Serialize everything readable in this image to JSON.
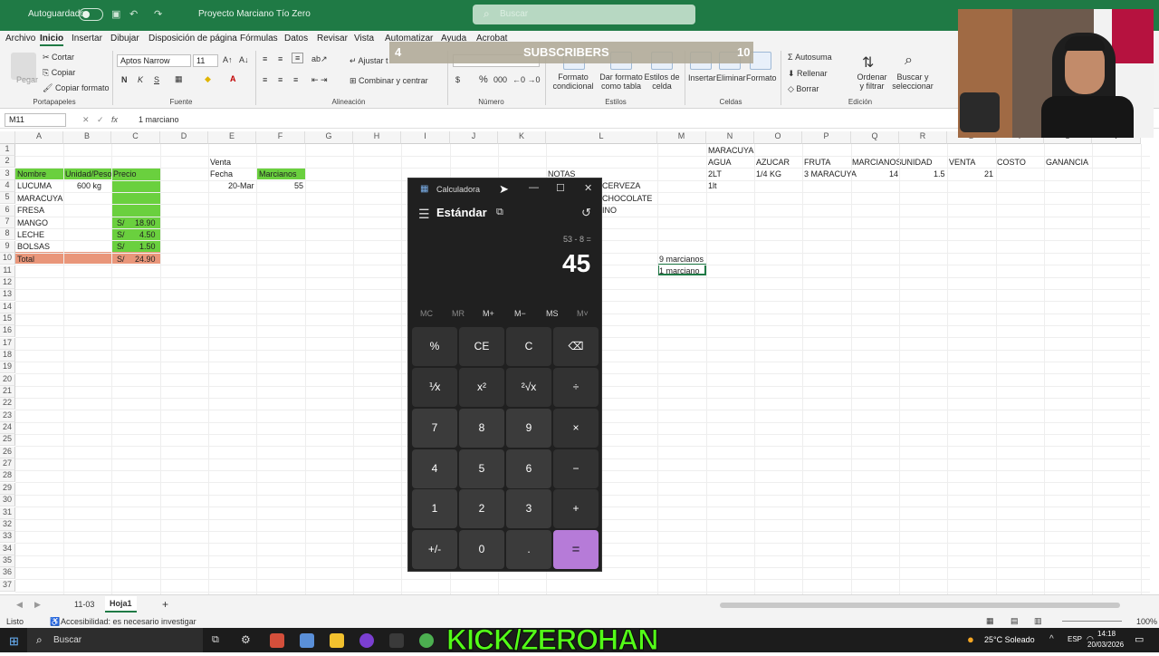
{
  "titlebar": {
    "autosave": "Autoguardado",
    "doc_title": "Proyecto Marciano Tío Zero",
    "search_placeholder": "Buscar"
  },
  "ribbon_tabs": [
    "Archivo",
    "Inicio",
    "Insertar",
    "Dibujar",
    "Disposición de página",
    "Fórmulas",
    "Datos",
    "Revisar",
    "Vista",
    "Automatizar",
    "Ayuda",
    "Acrobat"
  ],
  "ribbon": {
    "clipboard": {
      "paste": "Pegar",
      "cut": "Cortar",
      "copy": "Copiar",
      "format_painter": "Copiar formato",
      "group": "Portapapeles"
    },
    "font": {
      "name": "Aptos Narrow",
      "size": "11",
      "bold": "N",
      "italic": "K",
      "underline": "S",
      "group": "Fuente"
    },
    "alignment": {
      "wrap": "Ajustar t",
      "merge": "Combinar y centrar",
      "group": "Alineación"
    },
    "number": {
      "percent": "%",
      "group": "Número"
    },
    "styles": {
      "conditional": "Formato condicional",
      "as_table": "Dar formato como tabla",
      "cell_styles": "Estilos de celda",
      "group": "Estilos"
    },
    "cells": {
      "insert": "Insertar",
      "delete": "Eliminar",
      "format": "Formato",
      "group": "Celdas"
    },
    "editing": {
      "autosum": "Autosuma",
      "fill": "Rellenar",
      "clear": "Borrar",
      "sort": "Ordenar y filtrar",
      "find": "Buscar y seleccionar",
      "group": "Edición"
    }
  },
  "overlay": {
    "left_count": "4",
    "label": "SUBSCRIBERS",
    "right_count": "10",
    "brand": "KICK/ZEROHAN"
  },
  "formula": {
    "namebox": "M11",
    "fx": "fx",
    "value": "1 marciano"
  },
  "columns": [
    "A",
    "B",
    "C",
    "D",
    "E",
    "F",
    "G",
    "H",
    "I",
    "J",
    "K",
    "L",
    "M",
    "N",
    "O",
    "P",
    "Q",
    "R",
    "S",
    "T",
    "U",
    "V"
  ],
  "rows": [
    "1",
    "2",
    "3",
    "4",
    "5",
    "6",
    "7",
    "8",
    "9",
    "10",
    "11",
    "12",
    "13",
    "14",
    "15",
    "16",
    "17",
    "18",
    "19",
    "20",
    "21",
    "22",
    "23",
    "24",
    "25",
    "26",
    "27",
    "28",
    "29",
    "30",
    "31",
    "32",
    "33",
    "34",
    "35",
    "36",
    "37"
  ],
  "cells": {
    "a3": "Nombre",
    "b3": "Unidad/Peso",
    "c3": "Precio",
    "a4": "LUCUMA",
    "b4": "600 kg",
    "a5": "MARACUYA",
    "a6": "FRESA",
    "a7": "MANGO",
    "c7cur": "S/",
    "c7": "18.90",
    "a8": "LECHE",
    "c8cur": "S/",
    "c8": "4.50",
    "a9": "BOLSAS",
    "c9cur": "S/",
    "c9": "1.50",
    "a10": "Total",
    "c10cur": "S/",
    "c10": "24.90",
    "e2": "Venta",
    "e3": "Fecha",
    "f3": "Marcianos",
    "e4": "20-Mar",
    "f4": "55",
    "k3": "NOTAS",
    "l4": "CERVEZA",
    "l5": "CHOCOLATE",
    "l6": "INO",
    "m10": "9 marcianos",
    "m11": "1 marciano",
    "n1": "MARACUYA",
    "n2": "AGUA",
    "o2": "AZUCAR",
    "p2": "FRUTA",
    "q2": "MARCIANOS",
    "r2": "UNIDAD",
    "s2": "VENTA",
    "t2": "COSTO",
    "u2": "GANANCIA",
    "n3": "2LT",
    "o3": "1/4 KG",
    "p3": "3 MARACUYA",
    "q3": "14",
    "r3": "1.5",
    "s3": "21",
    "n4": "1lt"
  },
  "calculator": {
    "title": "Calculadora",
    "mode": "Estándar",
    "expression": "53 - 8 =",
    "display": "45",
    "memory": [
      "MC",
      "MR",
      "M+",
      "M−",
      "MS",
      "M˅"
    ],
    "keys": [
      [
        "%",
        "CE",
        "C",
        "⌫"
      ],
      [
        "⅟x",
        "x²",
        "²√x",
        "÷"
      ],
      [
        "7",
        "8",
        "9",
        "×"
      ],
      [
        "4",
        "5",
        "6",
        "−"
      ],
      [
        "1",
        "2",
        "3",
        "+"
      ],
      [
        "+/-",
        "0",
        ".",
        "="
      ]
    ]
  },
  "sheets": [
    "11-03",
    "Hoja1"
  ],
  "status": {
    "ready": "Listo",
    "accessibility": "Accesibilidad: es necesario investigar",
    "zoom": "100%"
  },
  "taskbar": {
    "search": "Buscar",
    "weather": "25°C Soleado",
    "lang": "ESP",
    "time": "14:18",
    "date": "20/03/2026"
  },
  "colors": {
    "excel_green": "#1f7a45",
    "header_fill": "#6ad03e",
    "total_fill": "#e9967a",
    "sel_fill": "#92d050",
    "calc_accent": "#b67bd8"
  }
}
